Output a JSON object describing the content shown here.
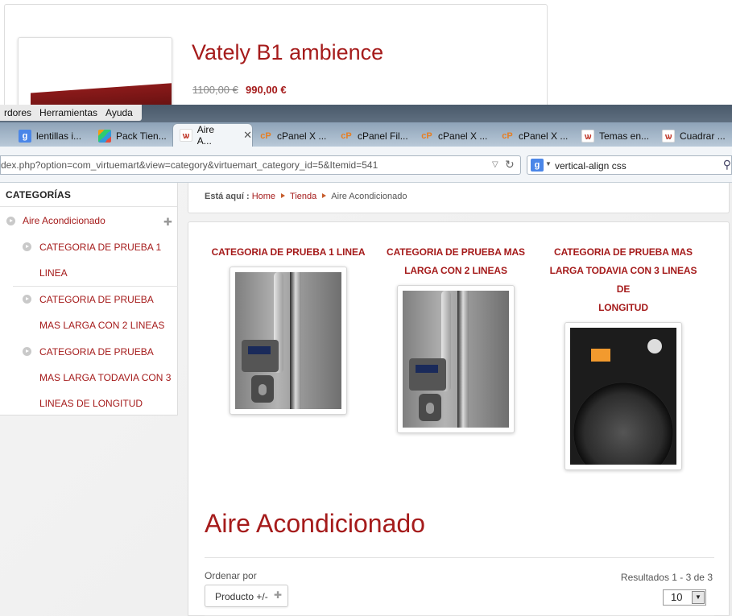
{
  "background_product": {
    "title": "Vately B1 ambience",
    "old_price": "1100,00 €",
    "new_price": "990,00 €"
  },
  "menubar": {
    "items": [
      "rdores",
      "Herramientas",
      "Ayuda"
    ]
  },
  "tabs": [
    {
      "label": "lentillas i...",
      "icon": "google-icon"
    },
    {
      "label": "Pack Tien...",
      "icon": "joomla-icon"
    },
    {
      "label": "Aire A...",
      "icon": "w-icon",
      "active": true
    },
    {
      "label": "cPanel X ...",
      "icon": "cpanel-icon"
    },
    {
      "label": "cPanel Fil...",
      "icon": "cpanel-icon"
    },
    {
      "label": "cPanel X ...",
      "icon": "cpanel-icon"
    },
    {
      "label": "cPanel X ...",
      "icon": "cpanel-icon"
    },
    {
      "label": "Temas en...",
      "icon": "w-icon"
    },
    {
      "label": "Cuadrar ...",
      "icon": "w-icon"
    }
  ],
  "navbar": {
    "url": "dex.php?option=com_virtuemart&view=category&virtuemart_category_id=5&Itemid=541",
    "search_value": "vertical-align css"
  },
  "sidebar": {
    "heading": "CATEGORÍAS",
    "parent": "Aire Acondicionado",
    "children": [
      {
        "lines": [
          "CATEGORIA DE PRUEBA 1",
          "LINEA"
        ]
      },
      {
        "lines": [
          "CATEGORIA DE PRUEBA",
          "MAS LARGA CON 2 LINEAS"
        ]
      },
      {
        "lines": [
          "CATEGORIA DE PRUEBA",
          "MAS LARGA TODAVIA CON 3",
          "LINEAS DE LONGITUD"
        ]
      }
    ]
  },
  "breadcrumb": {
    "label": "Está aquí :",
    "items": [
      "Home",
      "Tienda",
      "Aire Acondicionado"
    ]
  },
  "categories": [
    {
      "lines": [
        "CATEGORIA DE PRUEBA 1 LINEA"
      ],
      "image": "fridge"
    },
    {
      "lines": [
        "CATEGORIA DE PRUEBA MAS",
        "LARGA CON 2 LINEAS"
      ],
      "image": "fridge"
    },
    {
      "lines": [
        "CATEGORIA DE PRUEBA MAS",
        "LARGA TODAVIA CON 3 LINEAS DE",
        "LONGITUD"
      ],
      "image": "washer"
    }
  ],
  "main": {
    "heading": "Aire Acondicionado",
    "order_label": "Ordenar por",
    "order_button": "Producto +/-",
    "results": "Resultados 1 - 3 de 3",
    "per_page": "10"
  }
}
